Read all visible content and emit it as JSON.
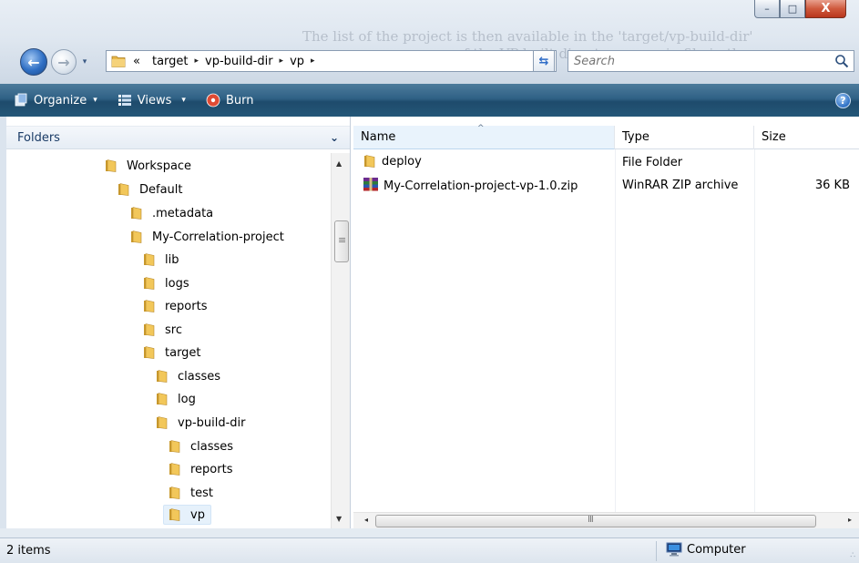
{
  "window": {
    "ghost_text_line1": "The list of the project is then available in the 'target/vp-build-dir'",
    "ghost_text_line2": "of the VP-built directory as a zip file in the",
    "caption_buttons": {
      "minimize": "–",
      "maximize": "□",
      "close": "X"
    }
  },
  "nav": {
    "back": "←",
    "forward": "→",
    "recent": "▾"
  },
  "address": {
    "prefix": "«",
    "crumbs": [
      "target",
      "vp-build-dir",
      "vp"
    ],
    "separator": "▸",
    "dropdown": "▾"
  },
  "refresh": "⇆",
  "search": {
    "placeholder": "Search"
  },
  "toolbar": {
    "organize": "Organize",
    "views": "Views",
    "burn": "Burn",
    "dropdown_arrow": "▾",
    "help": "?"
  },
  "folders_pane": {
    "title": "Folders",
    "collapse": "⌄",
    "items": [
      {
        "label": "Workspace",
        "level": 0
      },
      {
        "label": "Default",
        "level": 1
      },
      {
        "label": ".metadata",
        "level": 2
      },
      {
        "label": "My-Correlation-project",
        "level": 2
      },
      {
        "label": "lib",
        "level": 3
      },
      {
        "label": "logs",
        "level": 3
      },
      {
        "label": "reports",
        "level": 3
      },
      {
        "label": "src",
        "level": 3
      },
      {
        "label": "target",
        "level": 3
      },
      {
        "label": "classes",
        "level": 4
      },
      {
        "label": "log",
        "level": 4
      },
      {
        "label": "vp-build-dir",
        "level": 4
      },
      {
        "label": "classes",
        "level": 5
      },
      {
        "label": "reports",
        "level": 5
      },
      {
        "label": "test",
        "level": 5
      },
      {
        "label": "vp",
        "level": 5,
        "selected": true
      }
    ]
  },
  "file_list": {
    "columns": {
      "name": "Name",
      "type": "Type",
      "size": "Size"
    },
    "sort_indicator": "^",
    "rows": [
      {
        "name": "deploy",
        "type": "File Folder",
        "size": "",
        "icon": "folder-icon"
      },
      {
        "name": "My-Correlation-project-vp-1.0.zip",
        "type": "WinRAR ZIP archive",
        "size": "36 KB",
        "icon": "winrar-archive-icon"
      }
    ]
  },
  "scroll": {
    "up": "▲",
    "down": "▼",
    "left": "◂",
    "right": "▸"
  },
  "status": {
    "items": "2 items",
    "location": "Computer",
    "grip": "∴"
  },
  "colors": {
    "command_bar": "#2f6185",
    "selection": "#e6f1fb",
    "folder_yellow": "#e8b84a"
  }
}
